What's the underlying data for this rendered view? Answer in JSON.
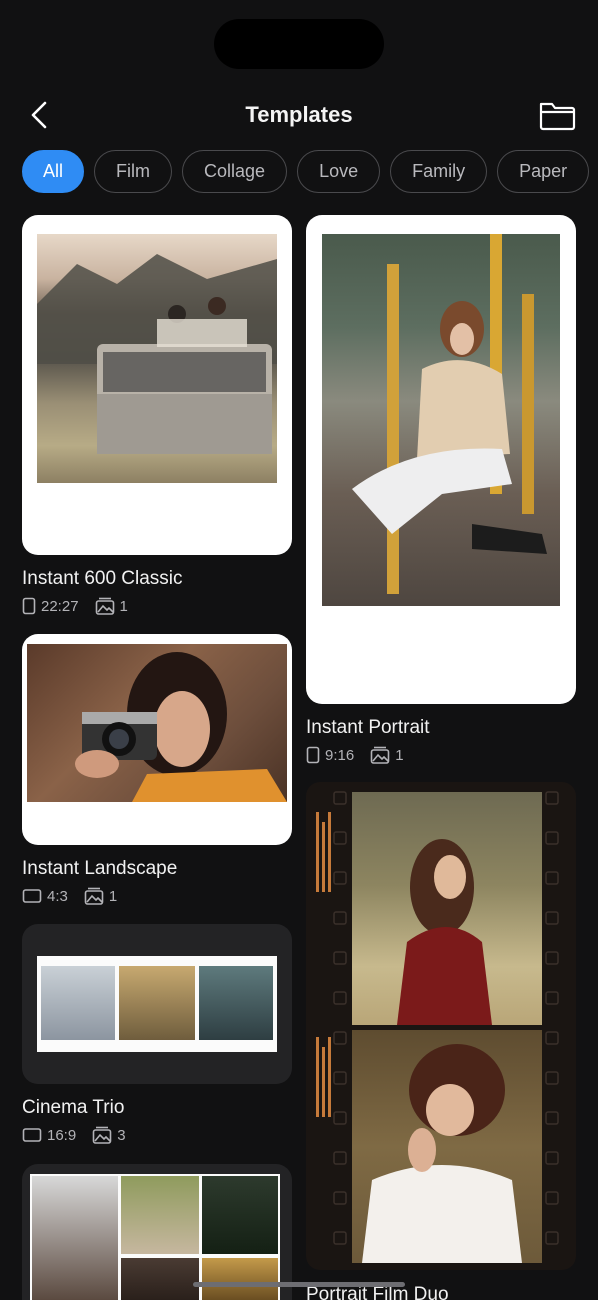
{
  "header": {
    "title": "Templates"
  },
  "filters": [
    "All",
    "Film",
    "Collage",
    "Love",
    "Family",
    "Paper"
  ],
  "templates": [
    {
      "name": "Instant 600 Classic",
      "ratio": "22:27",
      "photos": "1",
      "orientation": "portrait"
    },
    {
      "name": "Instant Portrait",
      "ratio": "9:16",
      "photos": "1",
      "orientation": "portrait"
    },
    {
      "name": "Instant Landscape",
      "ratio": "4:3",
      "photos": "1",
      "orientation": "landscape"
    },
    {
      "name": "Cinema Trio",
      "ratio": "16:9",
      "photos": "3",
      "orientation": "landscape"
    },
    {
      "name": "Portrait Film Duo"
    }
  ],
  "colors": {
    "accent": "#2f8cf4",
    "background": "#111112",
    "frame": "#ffffff"
  }
}
